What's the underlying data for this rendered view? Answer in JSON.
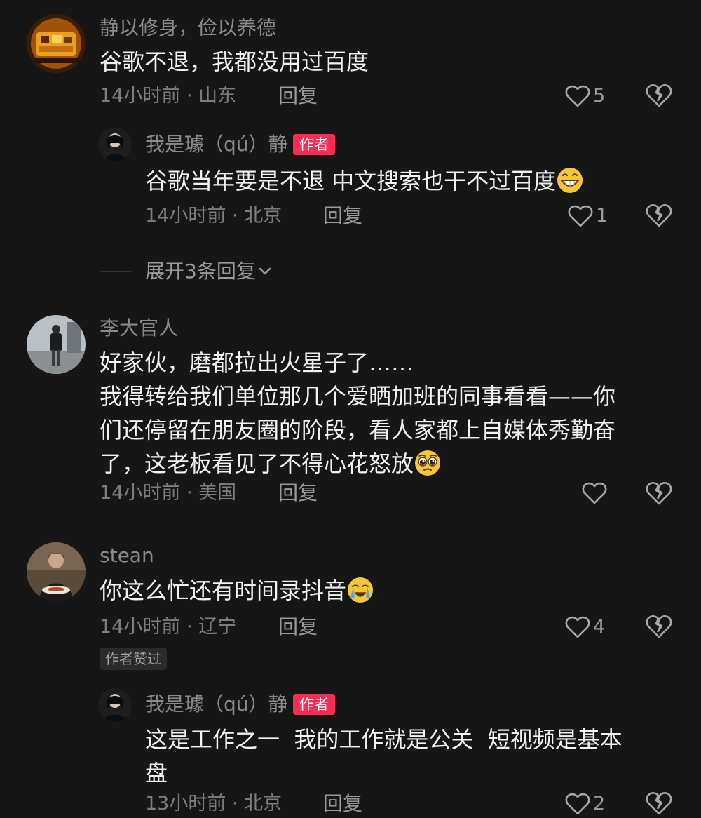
{
  "comments": [
    {
      "username": "静以修身，俭以养德",
      "text_lines": [
        "谷歌不退，我都没用过百度"
      ],
      "time": "14小时前",
      "location": "山东",
      "reply_label": "回复",
      "likes": "5",
      "avatar_icon": "food-photo-avatar",
      "replies": [
        {
          "username": "我是璩（qú）静",
          "badge": "作者",
          "text_lines": [
            "谷歌当年要是不退 中文搜索也干不过百度"
          ],
          "emoji": "grinning-face",
          "time": "14小时前",
          "location": "北京",
          "reply_label": "回复",
          "likes": "1",
          "avatar_icon": "portrait-avatar"
        }
      ],
      "expand_label": "展开3条回复"
    },
    {
      "username": "李大官人",
      "text_lines": [
        "好家伙，磨都拉出火星子了……",
        "我得转给我们单位那几个爱晒加班的同事看看——你",
        "们还停留在朋友圈的阶段，看人家都上自媒体秀勤奋",
        "了，这老板看见了不得心花怒放"
      ],
      "emoji": "pleading-face",
      "time": "14小时前",
      "location": "美国",
      "reply_label": "回复",
      "likes": "",
      "avatar_icon": "person-standing-avatar"
    },
    {
      "username": "stean",
      "text_lines": [
        "你这么忙还有时间录抖音"
      ],
      "emoji": "crying-face",
      "time": "14小时前",
      "location": "辽宁",
      "reply_label": "回复",
      "likes": "4",
      "liked_by_author": "作者赞过",
      "avatar_icon": "person-dining-avatar",
      "replies": [
        {
          "username": "我是璩（qú）静",
          "badge": "作者",
          "text_lines": [
            "这是工作之一  我的工作就是公关  短视频是基本",
            "盘"
          ],
          "time": "13小时前",
          "location": "北京",
          "reply_label": "回复",
          "likes": "2",
          "avatar_icon": "portrait-avatar"
        }
      ]
    }
  ],
  "meta_separator": "·",
  "colors": {
    "background": "#161616",
    "author_badge": "#fe2c55",
    "meta_text": "#7d7d7d",
    "username_text": "#8a8a8a"
  }
}
